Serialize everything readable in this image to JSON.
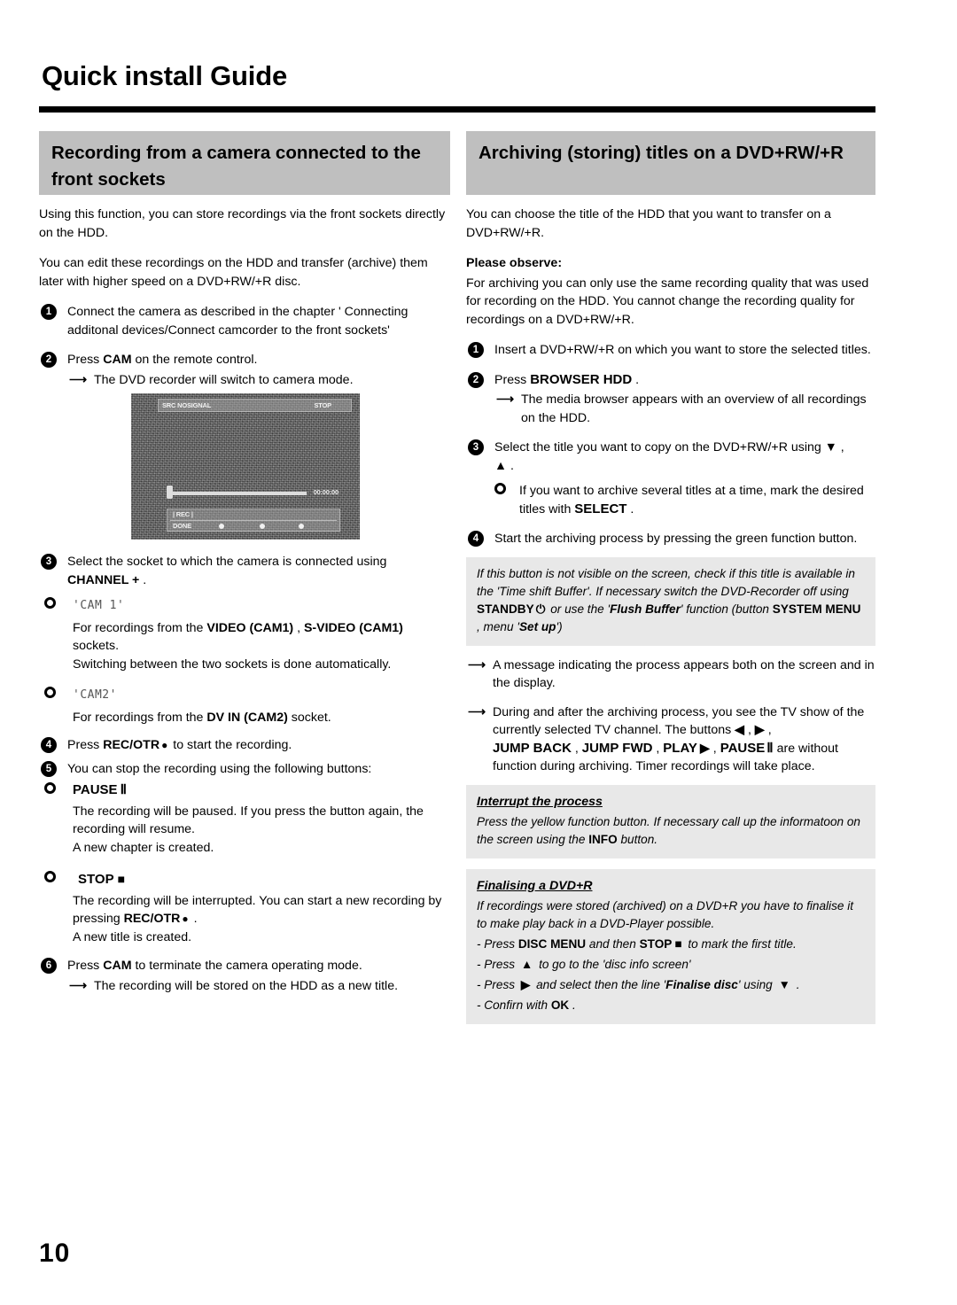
{
  "document": {
    "title": "Quick install Guide",
    "page_number": "10"
  },
  "left_column": {
    "section_title": "Recording from a camera connected to the front sockets",
    "intro": [
      "Using this function, you can store recordings via the front sockets directly on the HDD.",
      "You can edit these recordings on the HDD and transfer (archive) them later with higher speed on a DVD+RW/+R disc."
    ],
    "steps": [
      {
        "num": "1",
        "text": "Connect the camera as described in the chapter ' Connecting additonal devices/Connect camcorder to the front sockets'"
      },
      {
        "num": "2",
        "text_pre": "Press ",
        "button": "CAM",
        "text_post": " on the remote control.",
        "arrow": "The DVD recorder will switch to camera mode."
      },
      {
        "num": "3",
        "text_pre": "Select the socket to which the camera is connected using ",
        "button": "CHANNEL +",
        "text_post": " ."
      },
      {
        "num": "4",
        "text_pre": "Press ",
        "button": "REC/OTR",
        "glyph": "●",
        "text_post": " to start the recording."
      },
      {
        "num": "5",
        "text": "You can stop the recording using the following buttons:"
      },
      {
        "num": "6",
        "text_pre": "Press ",
        "button": "CAM",
        "text_post": " to terminate the camera operating mode.",
        "arrow": "The recording will be stored on the HDD as a new title."
      }
    ],
    "cam_options": [
      {
        "lcd_label": "'CAM 1'",
        "line1_pre": "For recordings from the ",
        "line1_b1": "VIDEO (CAM1)",
        "line1_mid": " , ",
        "line1_b2": "S-VIDEO (CAM1)",
        "line1_post": " sockets.",
        "line2": "Switching between the two sockets is done automatically."
      },
      {
        "lcd_label": "'CAM2'",
        "line1_pre": "For recordings from the ",
        "line1_b1": "DV IN (CAM2)",
        "line1_post": " socket."
      }
    ],
    "stop_options": [
      {
        "button": "PAUSE",
        "glyph": "Ⅱ",
        "lines": [
          "The recording will be paused. If you press the button again, the recording will resume.",
          "A new chapter is created."
        ]
      },
      {
        "button": "STOP",
        "glyph": "■",
        "lines_pre": "The recording will be interrupted. You can start a new recording by pressing ",
        "lines_btn": "REC/OTR",
        "lines_btn_glyph": "●",
        "lines_post": " .",
        "last_line": "A new title is created."
      }
    ],
    "tv_screenshot": {
      "osd_source": "SRC NOSIGNAL",
      "osd_status": "STOP",
      "osd_time": "00:00:00",
      "osd_rec": "| REC |",
      "osd_done": "DONE"
    }
  },
  "right_column": {
    "section_title": "Archiving (storing) titles on a DVD+RW/+R",
    "intro": "You can choose the title of the HDD that you want to transfer on a DVD+RW/+R.",
    "observe_heading": "Please observe:",
    "observe_text": "For archiving you can only use the same recording quality that was used for recording on the HDD. You cannot change the recording quality for recordings on a DVD+RW/+R.",
    "steps": [
      {
        "num": "1",
        "text": "Insert a DVD+RW/+R on which you want to store the selected titles."
      },
      {
        "num": "2",
        "text_pre": "Press ",
        "button": "BROWSER HDD",
        "text_post": " .",
        "arrow": "The media browser appears with an overview of all recordings on the HDD."
      },
      {
        "num": "3",
        "text_pre": "Select the title you want to copy on the DVD+RW/+R using ",
        "glyph_down": "▼",
        "mid": " , ",
        "glyph_up": "▲",
        "text_post": " .",
        "bullet_pre": "If you want to archive several titles at a time, mark the desired titles with ",
        "bullet_btn": "SELECT",
        "bullet_post": " ."
      },
      {
        "num": "4",
        "text": "Start the archiving process by pressing the green function button."
      }
    ],
    "note_flush": {
      "line1": "If this button is not visible on the screen, check if this title is available in the 'Time shift Buffer'. If necessary switch the DVD-Recorder off using ",
      "standby": "STANDBY",
      "standby_glyph": "⏻",
      "line2": " or use the '",
      "flush": "Flush Buffer",
      "line3": "' function (button ",
      "sysmenu": "SYSTEM MENU",
      "line4": " , menu '",
      "setup": "Set up",
      "line5": "')"
    },
    "arrows": [
      "A message indicating the process appears both on the screen and in the display."
    ],
    "arrow_buttons": {
      "pre": "During and after the archiving process, you see the TV show of the currently selected TV channel. The buttons ",
      "left_glyph": "◀",
      "right_glyph": "▶",
      "b1": "JUMP BACK",
      "b2": "JUMP FWD",
      "b3": "PLAY",
      "b3_glyph": "▶",
      "b4": "PAUSE",
      "b4_glyph": "Ⅱ",
      "post": " are without function during archiving. Timer recordings will take place."
    },
    "note_interrupt": {
      "heading": "Interrupt the process",
      "line_pre": "Press the yellow function button. If necessary call up the informatoon on the screen using the ",
      "button": "INFO",
      "line_post": " button."
    },
    "note_finalise": {
      "heading": "Finalising a DVD+R",
      "intro": "If recordings were stored (archived) on a DVD+R you have to finalise it to make play back in a DVD-Player possible.",
      "items": [
        {
          "pre": "- Press ",
          "b1": "DISC MENU",
          "mid": " and then ",
          "b2": "STOP",
          "glyph": "■",
          "post": " to mark the first title."
        },
        {
          "pre": "- Press ",
          "glyph": "▲",
          "post": " to go to the 'disc info screen'"
        },
        {
          "pre": "- Press ",
          "glyph": "▶",
          "mid": " and select then the line '",
          "bi": "Finalise disc",
          "post2": "' using ",
          "glyph2": "▼",
          "post3": " ."
        },
        {
          "pre": "- Confirn with ",
          "b1": "OK",
          "post": " ."
        }
      ]
    }
  },
  "colors": {
    "section_bar": "#bfbfbf",
    "note_box": "#e8e8e8",
    "rule": "#000000"
  }
}
